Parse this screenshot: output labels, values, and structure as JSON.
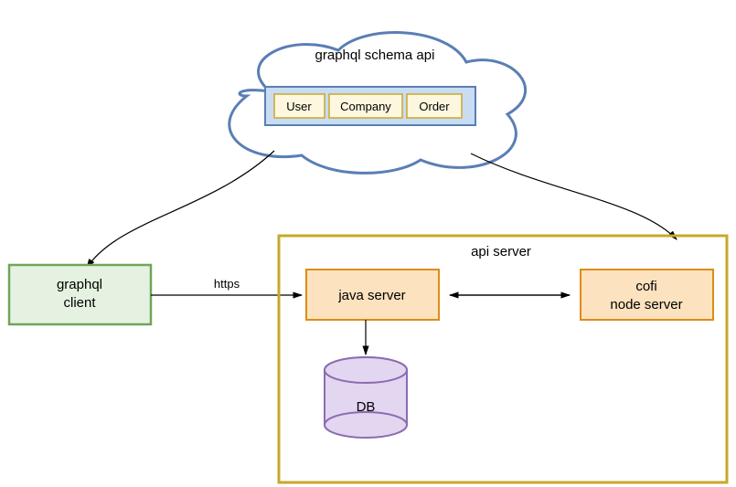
{
  "cloud": {
    "title": "graphql schema api",
    "entities": [
      "User",
      "Company",
      "Order"
    ]
  },
  "client": {
    "label": "graphql\nclient"
  },
  "backend": {
    "container_title": "api server",
    "java_label": "java server",
    "node_label": "cofi\nnode server",
    "db_label": "DB"
  },
  "edge": {
    "client_to_java": "https"
  },
  "colors": {
    "cloud_stroke": "#5a7eb5",
    "schema_fill": "#c9dcf2",
    "schema_stroke": "#5a7eb5",
    "entity_fill": "#fdf7df",
    "entity_stroke": "#c8a82a",
    "client_fill": "#e6f2e1",
    "client_stroke": "#6fa55a",
    "container_stroke": "#c8a82a",
    "server_fill": "#fce2be",
    "server_stroke": "#dd8c17",
    "db_fill": "#e3d6f0",
    "db_stroke": "#8b6cb0"
  }
}
